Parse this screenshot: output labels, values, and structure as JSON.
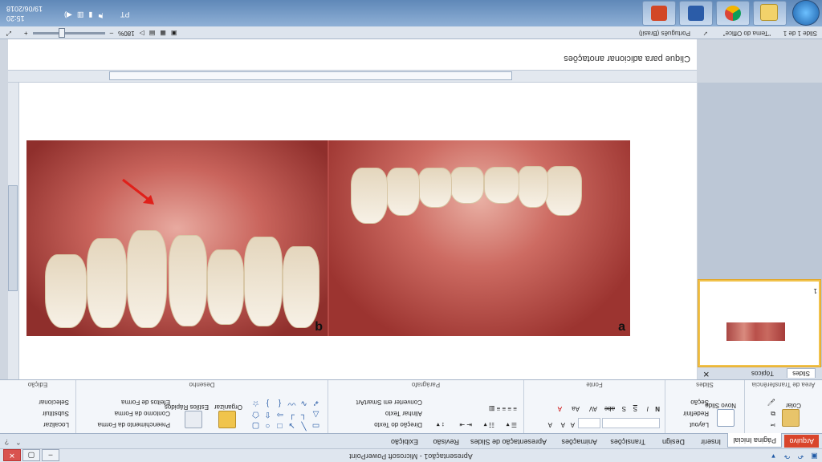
{
  "titlebar": {
    "title": "Apresentação1 - Microsoft PowerPoint",
    "qa_icons": [
      "save-icon",
      "undo-icon",
      "redo-icon",
      "customize-icon"
    ],
    "win_minimize": "–",
    "win_restore": "▢",
    "win_close": "✕"
  },
  "tabs": {
    "file": "Arquivo",
    "items": [
      "Página Inicial",
      "Inserir",
      "Design",
      "Transições",
      "Animações",
      "Apresentação de Slides",
      "Revisão",
      "Exibição"
    ],
    "help_icons": [
      "minimize-ribbon-icon",
      "help-icon"
    ]
  },
  "ribbon": {
    "clipboard": {
      "label": "Área de Transferência",
      "paste": "Colar"
    },
    "slides": {
      "label": "Slides",
      "new_slide": "Novo Slide",
      "layout": "Layout",
      "reset": "Redefinir",
      "section": "Seção"
    },
    "font": {
      "label": "Fonte",
      "bold": "N",
      "italic": "I",
      "underline": "S",
      "strike": "abc",
      "shadow": "S",
      "spacing": "AV",
      "size_up": "A",
      "size_down": "A",
      "case": "Aa",
      "color": "A",
      "clear": "A"
    },
    "paragraph": {
      "label": "Parágrafo",
      "direction": "Direção do Texto",
      "align_text": "Alinhar Texto",
      "smartart": "Converter em SmartArt"
    },
    "drawing": {
      "label": "Desenho",
      "arrange": "Organizar",
      "quick_styles": "Estilos Rápidos",
      "fill": "Preenchimento da Forma",
      "outline": "Contorno da Forma",
      "effects": "Efeitos de Forma"
    },
    "editing": {
      "label": "Edição",
      "find": "Localizar",
      "replace": "Substituir",
      "select": "Selecionar"
    }
  },
  "left_panel": {
    "tab_slides": "Slides",
    "tab_outline": "Tópicos",
    "close": "✕",
    "slide_number": "1"
  },
  "slide": {
    "label_a": "a",
    "label_b": "b"
  },
  "notes": {
    "placeholder": "Clique para adicionar anotações"
  },
  "status": {
    "slide_info": "Slide 1 de 1",
    "theme": "\"Tema do Office\"",
    "language": "Português (Brasil)",
    "zoom": "180%",
    "zoom_out": "–",
    "zoom_in": "+"
  },
  "taskbar": {
    "apps": [
      "windows-explorer",
      "chrome",
      "word",
      "powerpoint"
    ],
    "language": "PT",
    "time": "15:20",
    "date": "19/06/2018"
  },
  "colors": {
    "file_tab": "#d9452b",
    "thumb_highlight": "#f1c24b",
    "ribbon_bg": "#f3f6fa"
  }
}
